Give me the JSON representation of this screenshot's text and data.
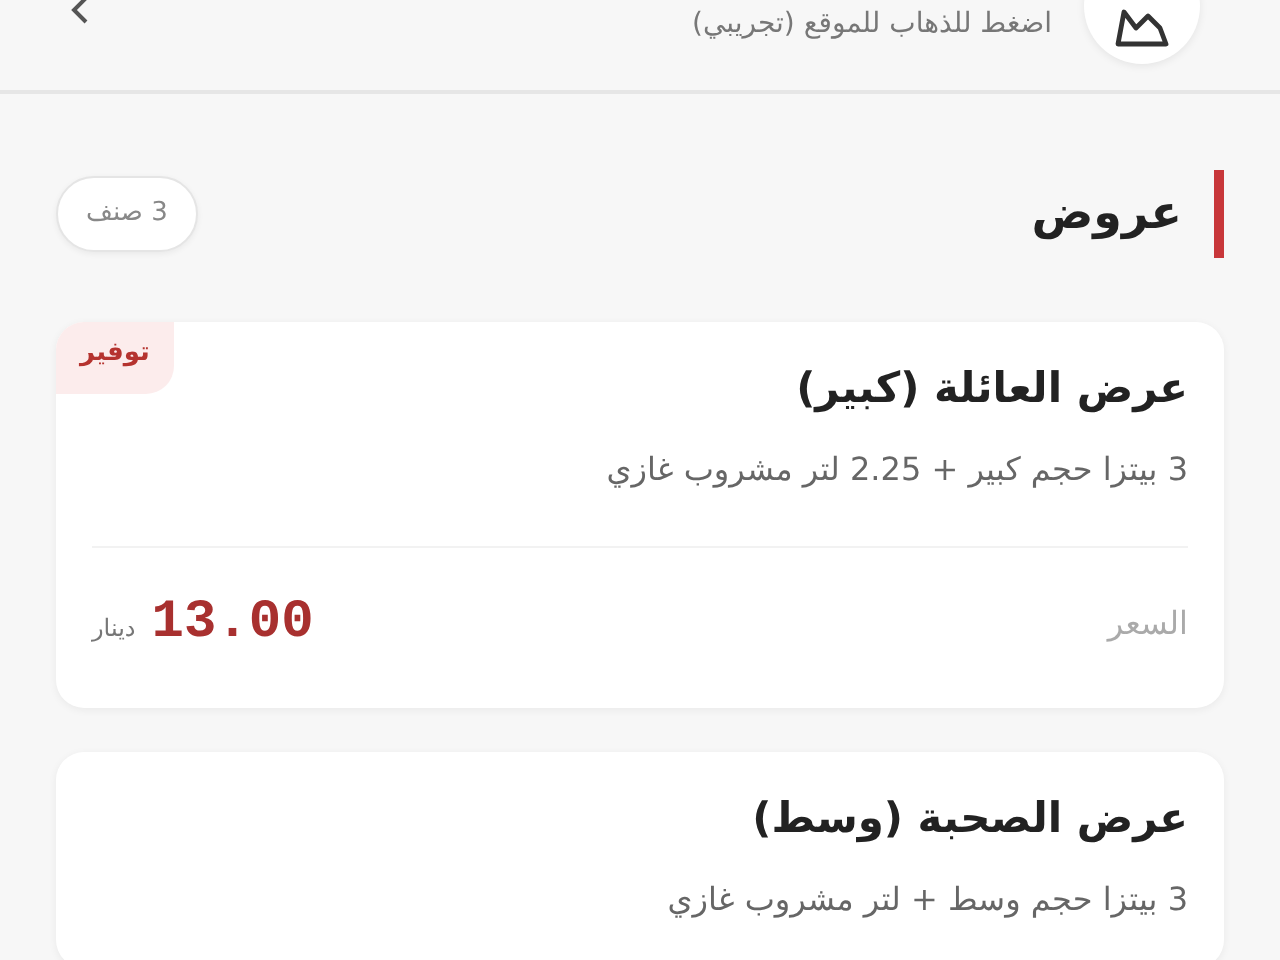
{
  "header": {
    "subtitle": "اضغط للذهاب للموقع (تجريبي)"
  },
  "section": {
    "title": "عروض",
    "count": "3 صنف"
  },
  "offers": [
    {
      "title": "عرض العائلة (كبير)",
      "description": "3 بيتزا حجم كبير + 2.25 لتر مشروب غازي",
      "badge": "توفير",
      "price_label": "السعر",
      "price": "13.00",
      "currency": "دينار"
    },
    {
      "title": "عرض الصحبة (وسط)",
      "description": "3 بيتزا حجم وسط + لتر مشروب غازي"
    }
  ]
}
